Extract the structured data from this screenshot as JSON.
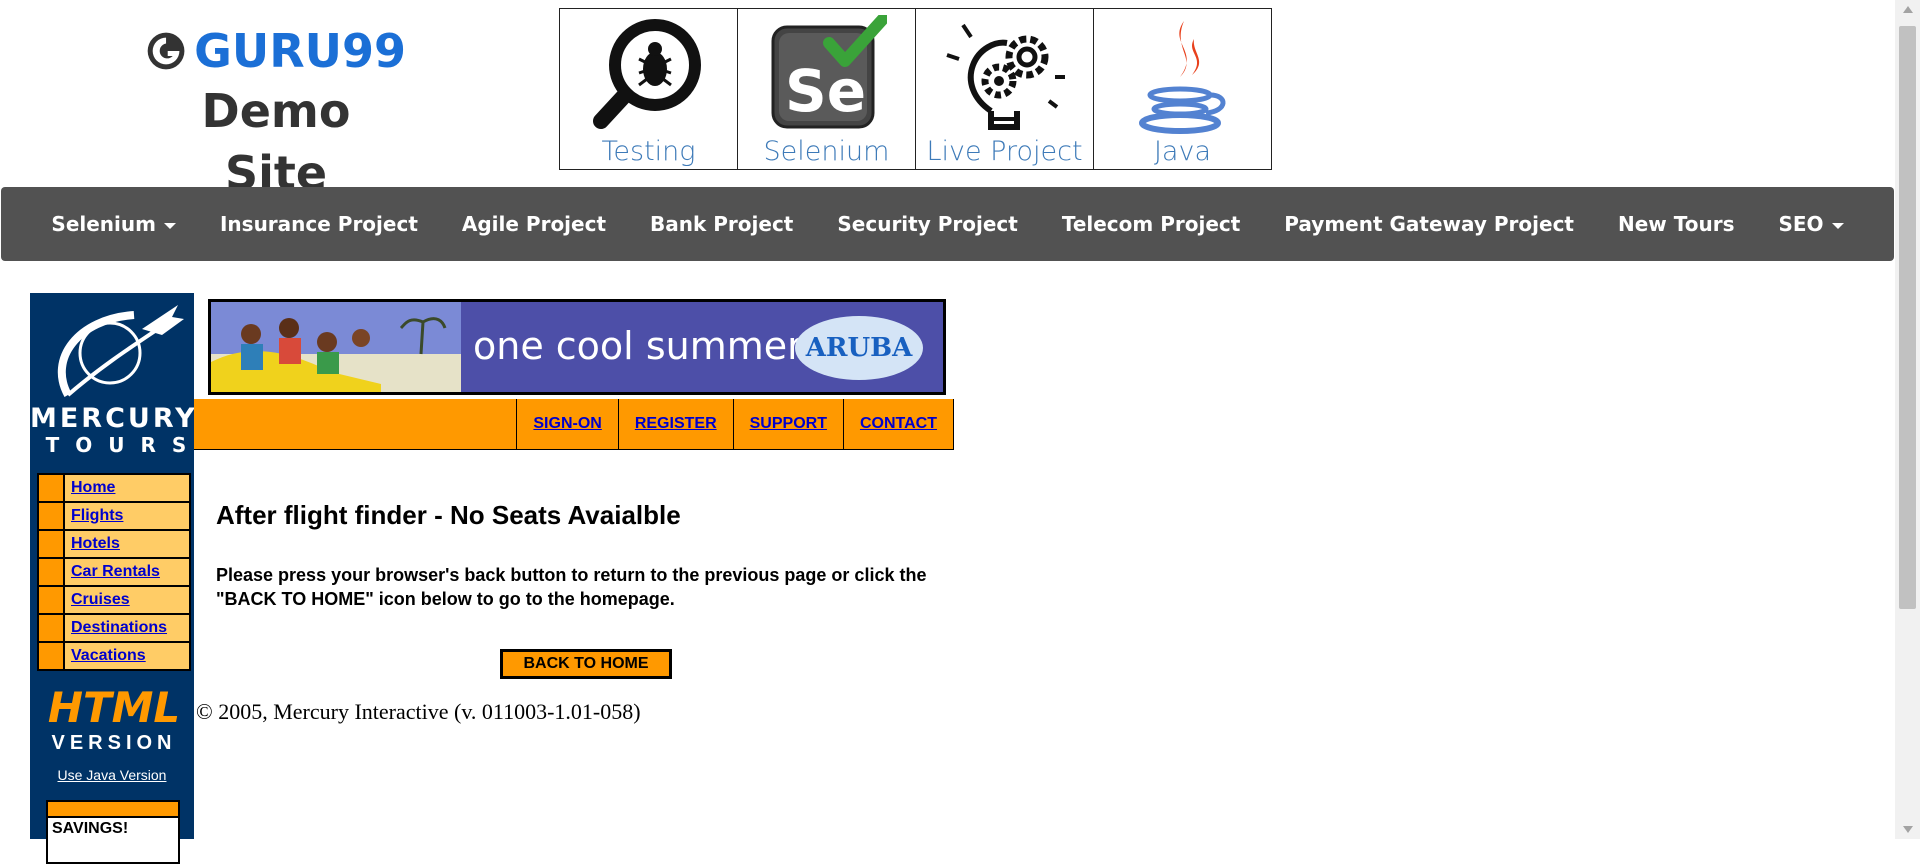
{
  "header": {
    "brand": "GURU99",
    "subtitle": "Demo Site",
    "tiles": [
      {
        "label": "Testing",
        "icon": "magnifier-bug-icon"
      },
      {
        "label": "Selenium",
        "icon": "selenium-logo-icon"
      },
      {
        "label": "Live Project",
        "icon": "lightbulb-gears-icon"
      },
      {
        "label": "Java",
        "icon": "java-cup-icon"
      }
    ]
  },
  "nav": {
    "items": [
      {
        "label": "Selenium",
        "dropdown": true
      },
      {
        "label": "Insurance Project",
        "dropdown": false
      },
      {
        "label": "Agile Project",
        "dropdown": false
      },
      {
        "label": "Bank Project",
        "dropdown": false
      },
      {
        "label": "Security Project",
        "dropdown": false
      },
      {
        "label": "Telecom Project",
        "dropdown": false
      },
      {
        "label": "Payment Gateway Project",
        "dropdown": false
      },
      {
        "label": "New Tours",
        "dropdown": false
      },
      {
        "label": "SEO",
        "dropdown": true
      }
    ]
  },
  "mercury": {
    "logo_line1": "MERCURY",
    "logo_line2": "TOURS",
    "menu": [
      "Home",
      "Flights",
      "Hotels",
      "Car Rentals",
      "Cruises",
      "Destinations",
      "Vacations"
    ],
    "html_version_line1": "HTML",
    "html_version_line2": "VERSION",
    "java_link": "Use Java Version",
    "savings": "SAVINGS!",
    "banner_text": "one cool summer",
    "banner_brand": "ARUBA",
    "top_links": [
      "SIGN-ON",
      "REGISTER",
      "SUPPORT",
      "CONTACT"
    ],
    "heading": "After flight finder - No Seats Avaialble",
    "message": "Please press your browser's back button to return to the previous page or click the \"BACK TO HOME\" icon below to go to the homepage.",
    "back_button": "BACK TO HOME",
    "copyright": "© 2005, Mercury Interactive (v. 011003-1.01-058)"
  },
  "colors": {
    "brand_blue": "#1b6fd6",
    "navbar": "#525252",
    "mercury_navy": "#003366",
    "mercury_orange": "#ff9900",
    "menu_yellow": "#ffcc66",
    "link_blue": "#0000cc"
  }
}
